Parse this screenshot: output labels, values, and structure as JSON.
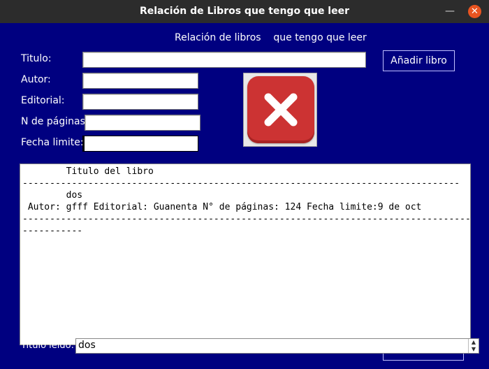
{
  "window": {
    "title": "Relación de Libros que tengo que leer",
    "minimize_icon": "minimize-icon",
    "close_icon": "close-icon",
    "close_color": "#e95420"
  },
  "header": {
    "heading": "Relación de libros    que tengo que leer"
  },
  "form": {
    "titulo_label": "Titulo:",
    "autor_label": "Autor:",
    "editorial_label": "Editorial:",
    "paginas_label": "N de páginas:",
    "fecha_label": "Fecha limite:",
    "titulo_value": "",
    "autor_value": "",
    "editorial_value": "",
    "paginas_value": "",
    "fecha_value": ""
  },
  "buttons": {
    "add_label": "Añadir libro",
    "delete_icon": "delete-x-icon"
  },
  "output": {
    "lines": [
      "        Titulo del libro",
      "--------------------------------------------------------------------------------",
      "        dos",
      " Autor: gfff Editorial: Guanenta N° de páginas: 124 Fecha limite:9 de oct",
      "-------------------------------------------------------------------------------------------",
      "-----------"
    ]
  },
  "bottom": {
    "label": "Titulo leido:",
    "combo_value": "dos"
  },
  "colors": {
    "background": "#000080",
    "titlebar": "#2c2c2c",
    "delete_red": "#cc3333"
  }
}
